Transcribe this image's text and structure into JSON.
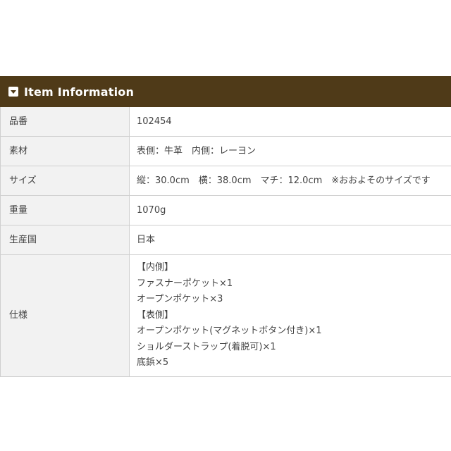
{
  "header": {
    "icon": "chevron-down-box-icon",
    "title": "Item Information"
  },
  "rows": [
    {
      "label": "品番",
      "value": "102454"
    },
    {
      "label": "素材",
      "value": "表側：牛革　内側：レーヨン"
    },
    {
      "label": "サイズ",
      "value": "縦：30.0cm　横：38.0cm　マチ：12.0cm　※おおよそのサイズです"
    },
    {
      "label": "重量",
      "value": "1070g"
    },
    {
      "label": "生産国",
      "value": "日本"
    }
  ],
  "spec": {
    "label": "仕様",
    "lines": [
      "【内側】",
      "ファスナーポケット×1",
      "オープンポケット×3",
      "【表側】",
      "オープンポケット(マグネットボタン付き)×1",
      "ショルダーストラップ(着脱可)×1",
      "底鋲×5"
    ]
  },
  "colors": {
    "header_bg": "#4f3a18",
    "label_bg": "#f2f2f2",
    "border": "#cfcfcf"
  }
}
